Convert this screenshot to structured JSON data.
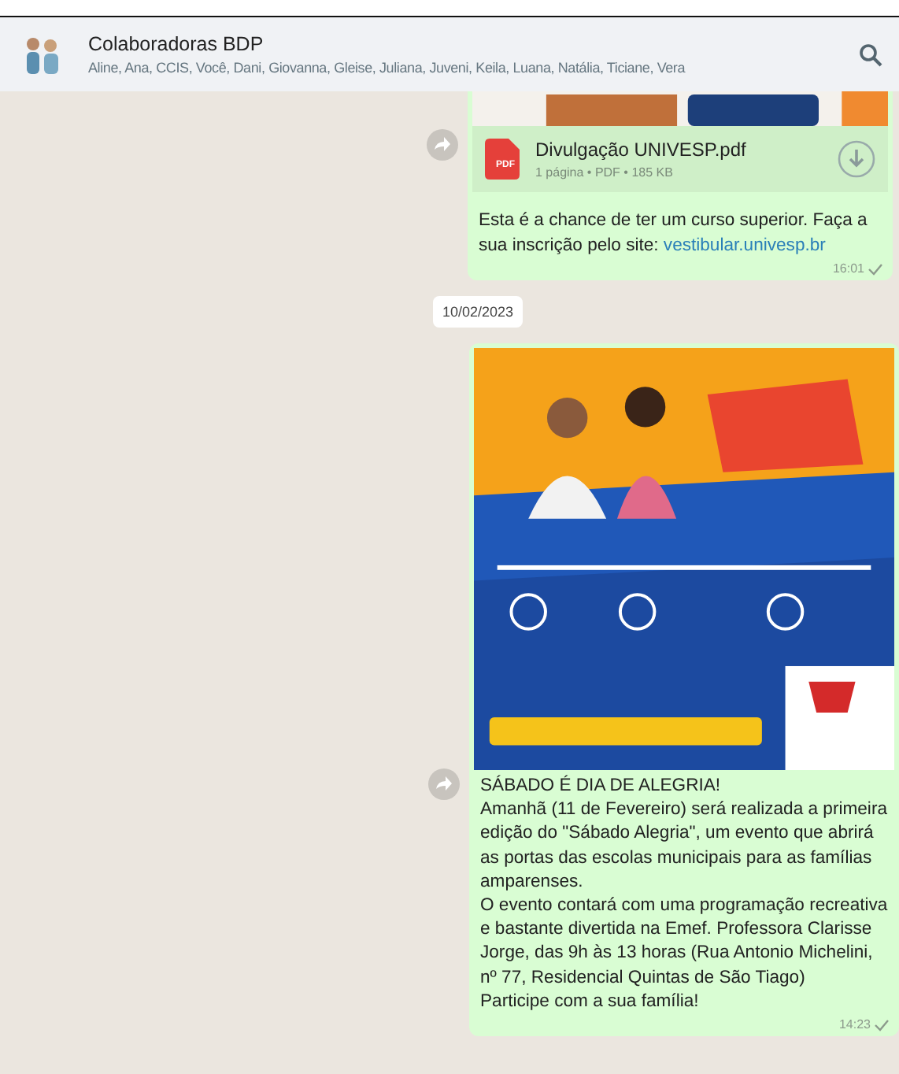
{
  "header": {
    "title": "Colaboradoras BDP",
    "members": "Aline, Ana, CCIS, Você, Dani, Giovanna, Gleise, Juliana, Juveni, Keila, Luana, Natália, Ticiane, Vera"
  },
  "messages": [
    {
      "kind": "document",
      "file_name": "Divulgação UNIVESP.pdf",
      "file_icon": "PDF",
      "file_info": "1 página • PDF • 185 KB",
      "caption": "Esta é a chance de ter um curso superior. Faça a sua inscrição pelo site: ",
      "link": "vestibular.univesp.br",
      "time": "16:01"
    },
    {
      "kind": "date",
      "text": "10/02/2023"
    },
    {
      "paragraphs": [
        "SÁBADO É DIA DE ALEGRIA!",
        "Amanhã (11 de Fevereiro) será realizada a primeira edição do \"Sábado Alegria\", um evento que abrirá as portas das escolas municipais para as famílias amparenses.",
        "O evento contará com uma programação recreativa e bastante divertida na Emef. Professora Clarisse Jorge, das 9h às 13 horas (Rua Antonio Michelini, nº 77, Residencial Quintas de São Tiago)",
        "Participe com a sua família!"
      ],
      "time": "14:23"
    }
  ]
}
